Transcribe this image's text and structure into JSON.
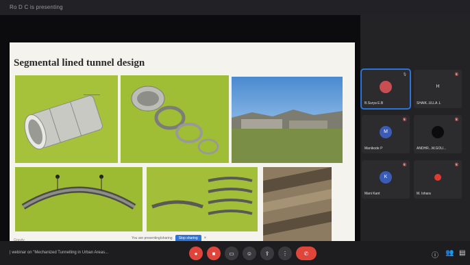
{
  "window": {
    "title": "Ro D C is presenting"
  },
  "slide": {
    "title": "Segmental lined tunnel design",
    "corner_note": "Gravity",
    "share_bar": {
      "message": "You are presenting/sharing",
      "stop_label": "Stop sharing",
      "close_symbol": "×"
    }
  },
  "participants": [
    {
      "name": "B.Surya E.B",
      "mic": "🎙",
      "avatar": "",
      "style": "photo",
      "active": true
    },
    {
      "name": "SHAIK..ULLA .L",
      "mic": "🔇",
      "avatar": "H",
      "style": "plain",
      "active": false
    },
    {
      "name": "Manikode P",
      "mic": "🔇",
      "avatar": "M",
      "style": "blue",
      "active": false
    },
    {
      "name": "ANDHR...M.GOU...",
      "mic": "🔇",
      "avatar": "",
      "style": "dark",
      "active": false
    },
    {
      "name": "Mani Kant",
      "mic": "🔇",
      "avatar": "K",
      "style": "blue",
      "active": false
    },
    {
      "name": "M. Ishara",
      "mic": "🔇",
      "avatar": "",
      "style": "red",
      "active": false
    }
  ],
  "meeting": {
    "label": "| webinar on \"Mechanized Tunnelling in Urban Areas..."
  },
  "controls": [
    "mic-off",
    "camera-off",
    "captions",
    "emoji",
    "present",
    "more",
    "end-call"
  ],
  "colors": {
    "accent": "#2d74da",
    "danger": "#e0453b",
    "slide_green": "#a6c13a"
  }
}
